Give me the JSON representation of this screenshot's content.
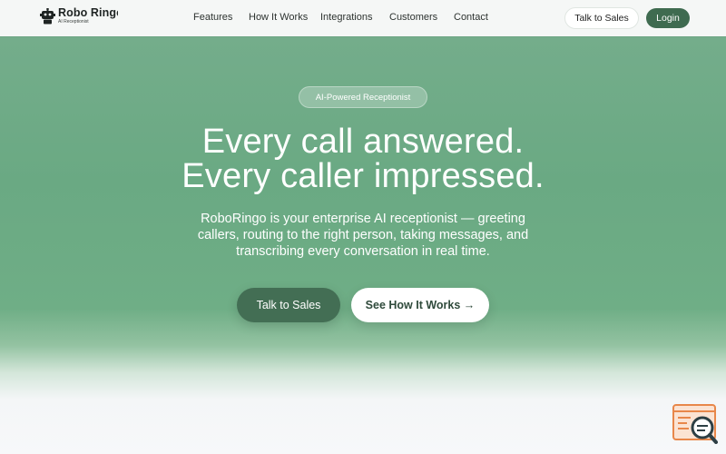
{
  "brand": {
    "name": "Robo Ringo",
    "subtitle": "AI Receptionist",
    "icon": "robot-icon"
  },
  "nav": {
    "links": [
      "Features",
      "How It Works",
      "Integrations",
      "Customers",
      "Contact"
    ],
    "talk_to_sales": "Talk to Sales",
    "login": "Login"
  },
  "hero": {
    "badge": "AI-Powered Receptionist",
    "headline_line1": "Every call answered.",
    "headline_line2": "Every caller impressed.",
    "subheadline_line1": "RoboRingo is your enterprise AI receptionist — greeting",
    "subheadline_line2": "callers, routing to the right person, taking messages, and",
    "subheadline_line3": "transcribing every conversation in real time.",
    "cta_primary": "Talk to Sales",
    "cta_secondary": "See How It Works →"
  },
  "widget": {
    "icon": "chat-search-icon"
  },
  "colors": {
    "accent": "#3f6b50",
    "hero_green": "#6fae86",
    "widget_orange": "#e8874a"
  }
}
